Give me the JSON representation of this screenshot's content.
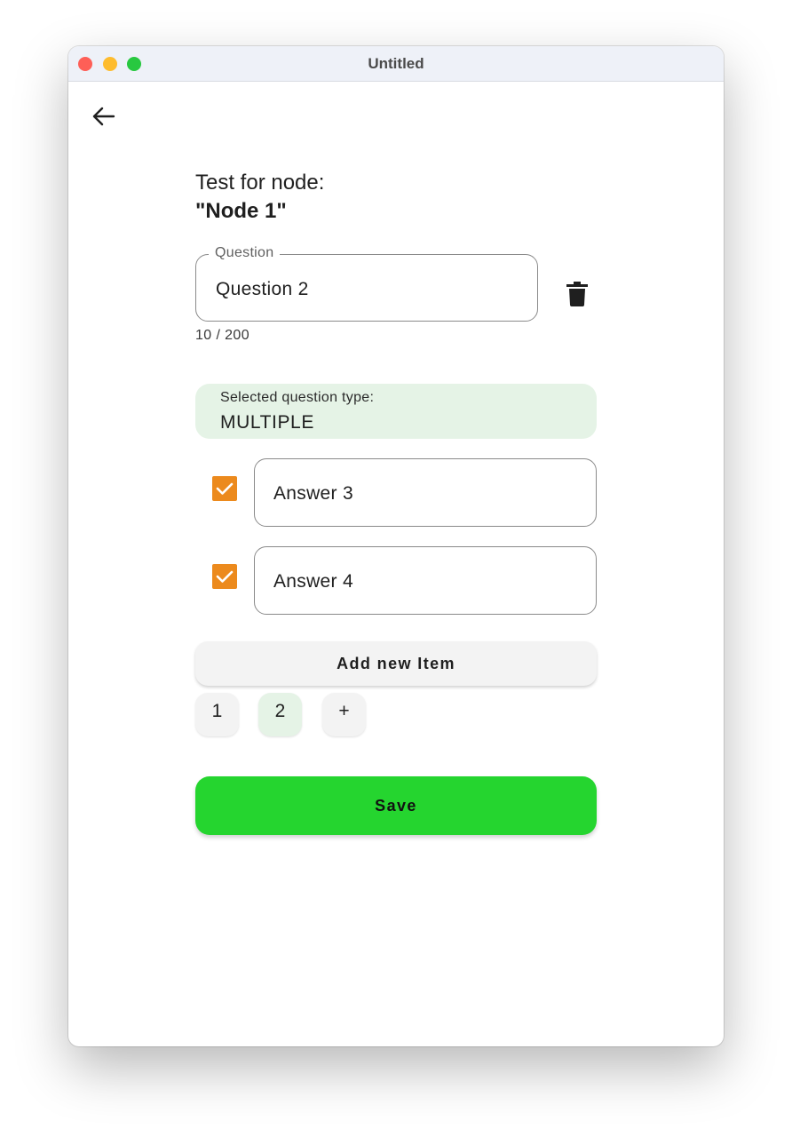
{
  "window": {
    "title": "Untitled"
  },
  "header": {
    "back_icon": "arrow-left-icon",
    "title_line1": "Test for node:",
    "title_line2": "\"Node 1\""
  },
  "question": {
    "label": "Question",
    "value": "Question 2",
    "counter": "10 / 200",
    "delete_icon": "trash-icon"
  },
  "question_type": {
    "label": "Selected question type:",
    "value": "MULTIPLE"
  },
  "answers": [
    {
      "value": "Answer 3",
      "checked": true
    },
    {
      "value": "Answer 4",
      "checked": true
    }
  ],
  "add_item_label": "Add new Item",
  "pagination": {
    "pages": [
      "1",
      "2"
    ],
    "active_page": "2",
    "add_label": "+"
  },
  "save_label": "Save",
  "colors": {
    "checkbox": "#ec8a1d",
    "save_button": "#25d52f",
    "selected_bg": "#e5f3e6"
  }
}
